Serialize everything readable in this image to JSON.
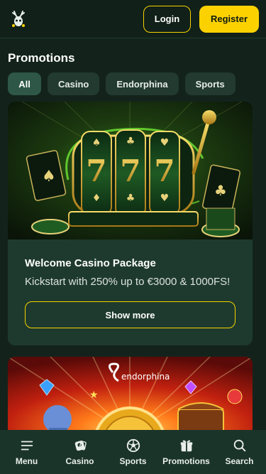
{
  "header": {
    "logo_icon": "deer-logo-icon",
    "login_label": "Login",
    "register_label": "Register"
  },
  "page": {
    "title": "Promotions"
  },
  "tabs": [
    {
      "label": "All",
      "active": true
    },
    {
      "label": "Casino",
      "active": false
    },
    {
      "label": "Endorphina",
      "active": false
    },
    {
      "label": "Sports",
      "active": false
    }
  ],
  "promotions": [
    {
      "title": "Welcome Casino Package",
      "subtitle": "Kickstart with 250% up to €3000 & 1000FS!",
      "button_label": "Show more"
    },
    {
      "brand": "endorphina"
    }
  ],
  "bottom_nav": [
    {
      "label": "Menu",
      "icon": "menu-icon"
    },
    {
      "label": "Casino",
      "icon": "casino-chip-icon"
    },
    {
      "label": "Sports",
      "icon": "soccer-ball-icon"
    },
    {
      "label": "Promotions",
      "icon": "gift-icon"
    },
    {
      "label": "Search",
      "icon": "search-icon"
    }
  ],
  "colors": {
    "accent": "#fbd200",
    "background": "#13231c",
    "card": "#1e3a2e"
  }
}
